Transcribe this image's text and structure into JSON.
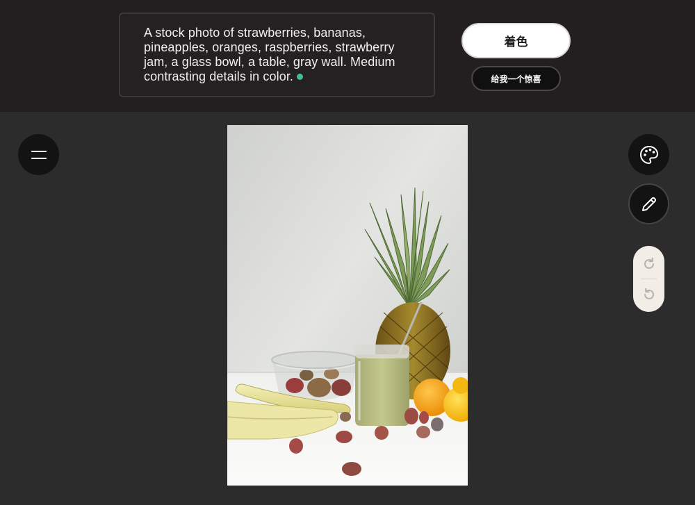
{
  "prompt": {
    "text": "A stock photo of strawberries, bananas, pineapples, oranges, raspberries, strawberry jam, a glass bowl, a table, gray wall. Medium contrasting details in color."
  },
  "actions": {
    "primary_label": "着色",
    "secondary_label": "给我一个惊喜"
  },
  "tools": {
    "menu_icon": "hamburger-icon",
    "palette_icon": "palette-icon",
    "pencil_icon": "pencil-icon",
    "redo_icon": "redo-icon",
    "undo_icon": "undo-icon"
  },
  "colors": {
    "background": "#2d2c2d",
    "topbar": "#231f20",
    "status_dot": "#3fbf94",
    "history_pill": "#f2eee7"
  }
}
